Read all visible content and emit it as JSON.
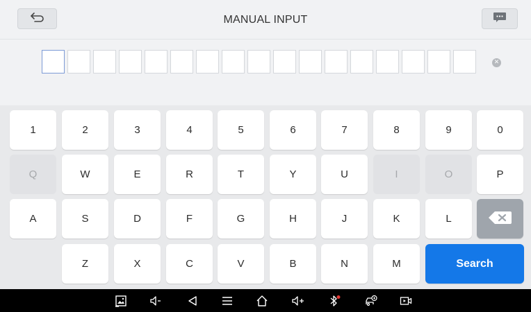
{
  "header": {
    "title": "MANUAL INPUT",
    "back_icon": "back-arrow-icon",
    "message_icon": "chat-bubble-icon"
  },
  "vin_input": {
    "box_count": 17,
    "active_index": 0,
    "values": [
      "",
      "",
      "",
      "",
      "",
      "",
      "",
      "",
      "",
      "",
      "",
      "",
      "",
      "",
      "",
      "",
      ""
    ],
    "clear_icon": "clear-icon"
  },
  "keyboard": {
    "rows": [
      [
        {
          "label": "1",
          "enabled": true
        },
        {
          "label": "2",
          "enabled": true
        },
        {
          "label": "3",
          "enabled": true
        },
        {
          "label": "4",
          "enabled": true
        },
        {
          "label": "5",
          "enabled": true
        },
        {
          "label": "6",
          "enabled": true
        },
        {
          "label": "7",
          "enabled": true
        },
        {
          "label": "8",
          "enabled": true
        },
        {
          "label": "9",
          "enabled": true
        },
        {
          "label": "0",
          "enabled": true
        }
      ],
      [
        {
          "label": "Q",
          "enabled": false
        },
        {
          "label": "W",
          "enabled": true
        },
        {
          "label": "E",
          "enabled": true
        },
        {
          "label": "R",
          "enabled": true
        },
        {
          "label": "T",
          "enabled": true
        },
        {
          "label": "Y",
          "enabled": true
        },
        {
          "label": "U",
          "enabled": true
        },
        {
          "label": "I",
          "enabled": false
        },
        {
          "label": "O",
          "enabled": false
        },
        {
          "label": "P",
          "enabled": true
        }
      ],
      [
        {
          "label": "A",
          "enabled": true
        },
        {
          "label": "S",
          "enabled": true
        },
        {
          "label": "D",
          "enabled": true
        },
        {
          "label": "F",
          "enabled": true
        },
        {
          "label": "G",
          "enabled": true
        },
        {
          "label": "H",
          "enabled": true
        },
        {
          "label": "J",
          "enabled": true
        },
        {
          "label": "K",
          "enabled": true
        },
        {
          "label": "L",
          "enabled": true
        }
      ],
      [
        {
          "label": "Z",
          "enabled": true
        },
        {
          "label": "X",
          "enabled": true
        },
        {
          "label": "C",
          "enabled": true
        },
        {
          "label": "V",
          "enabled": true
        },
        {
          "label": "B",
          "enabled": true
        },
        {
          "label": "N",
          "enabled": true
        },
        {
          "label": "M",
          "enabled": true
        }
      ]
    ],
    "backspace_icon": "backspace-icon",
    "search_label": "Search"
  },
  "navbar": {
    "icons": [
      "screenshot-icon",
      "volume-down-icon",
      "nav-back-icon",
      "menu-icon",
      "home-icon",
      "volume-up-icon",
      "bluetooth-icon",
      "vehicle-diagnostics-icon",
      "screen-record-icon"
    ]
  },
  "colors": {
    "accent": "#1478e8",
    "background": "#e8e9eb",
    "header": "#f1f2f4",
    "disabled_key": "#e1e2e5",
    "backspace_key": "#9fa5ac",
    "bluetooth_dot": "#e53935"
  }
}
